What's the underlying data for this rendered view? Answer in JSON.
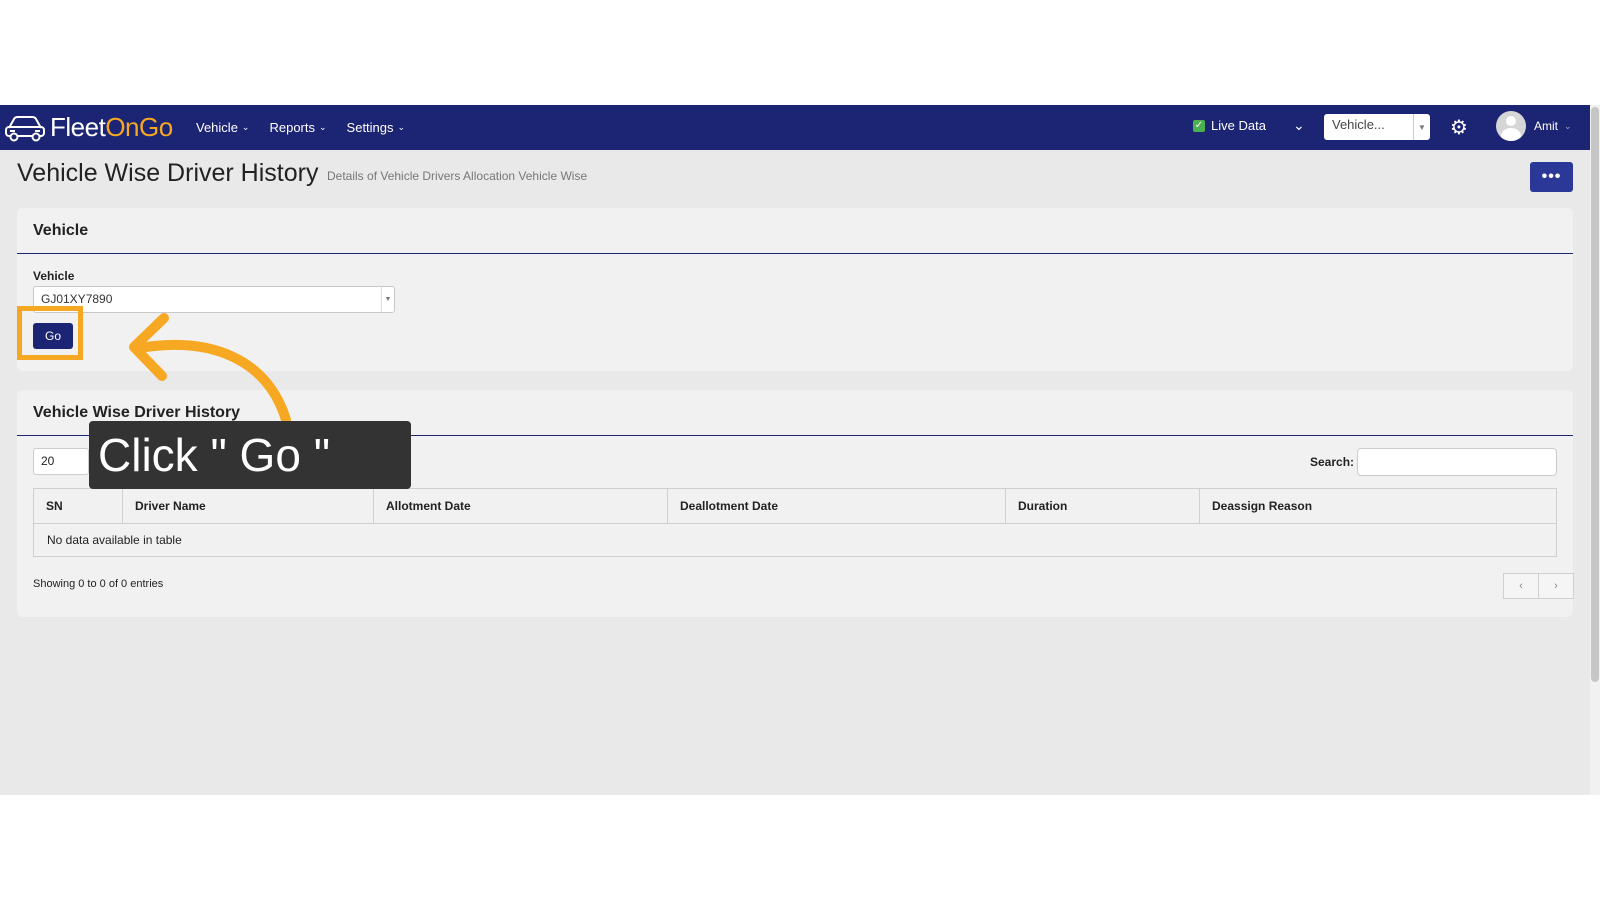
{
  "navbar": {
    "logo": {
      "part1": "Fleet",
      "part2": "OnGo"
    },
    "menu": [
      {
        "label": "Vehicle"
      },
      {
        "label": "Reports"
      },
      {
        "label": "Settings"
      }
    ],
    "live_data_label": "Live Data",
    "vehicle_select_value": "Vehicle...",
    "user_name": "Amit"
  },
  "page": {
    "title": "Vehicle Wise Driver History",
    "subtitle": "Details of Vehicle Drivers Allocation Vehicle Wise",
    "more_label": "•••"
  },
  "vehicle_card": {
    "header": "Vehicle",
    "field_label": "Vehicle",
    "selected_vehicle": "GJ01XY7890",
    "go_label": "Go"
  },
  "history_card": {
    "header": "Vehicle Wise Driver History",
    "page_length": "20",
    "search_label": "Search:",
    "columns": [
      "SN",
      "Driver Name",
      "Allotment Date",
      "Deallotment Date",
      "Duration",
      "Deassign Reason"
    ],
    "empty_message": "No data available in table",
    "info": "Showing 0 to 0 of 0 entries",
    "prev_label": "‹",
    "next_label": "›"
  },
  "annotation": {
    "tooltip_text": "Click \" Go \"",
    "accent_color": "#f7a823"
  },
  "colors": {
    "navbar": "#1c2474",
    "button": "#1c2474",
    "page_bg": "#e9e9ea"
  }
}
